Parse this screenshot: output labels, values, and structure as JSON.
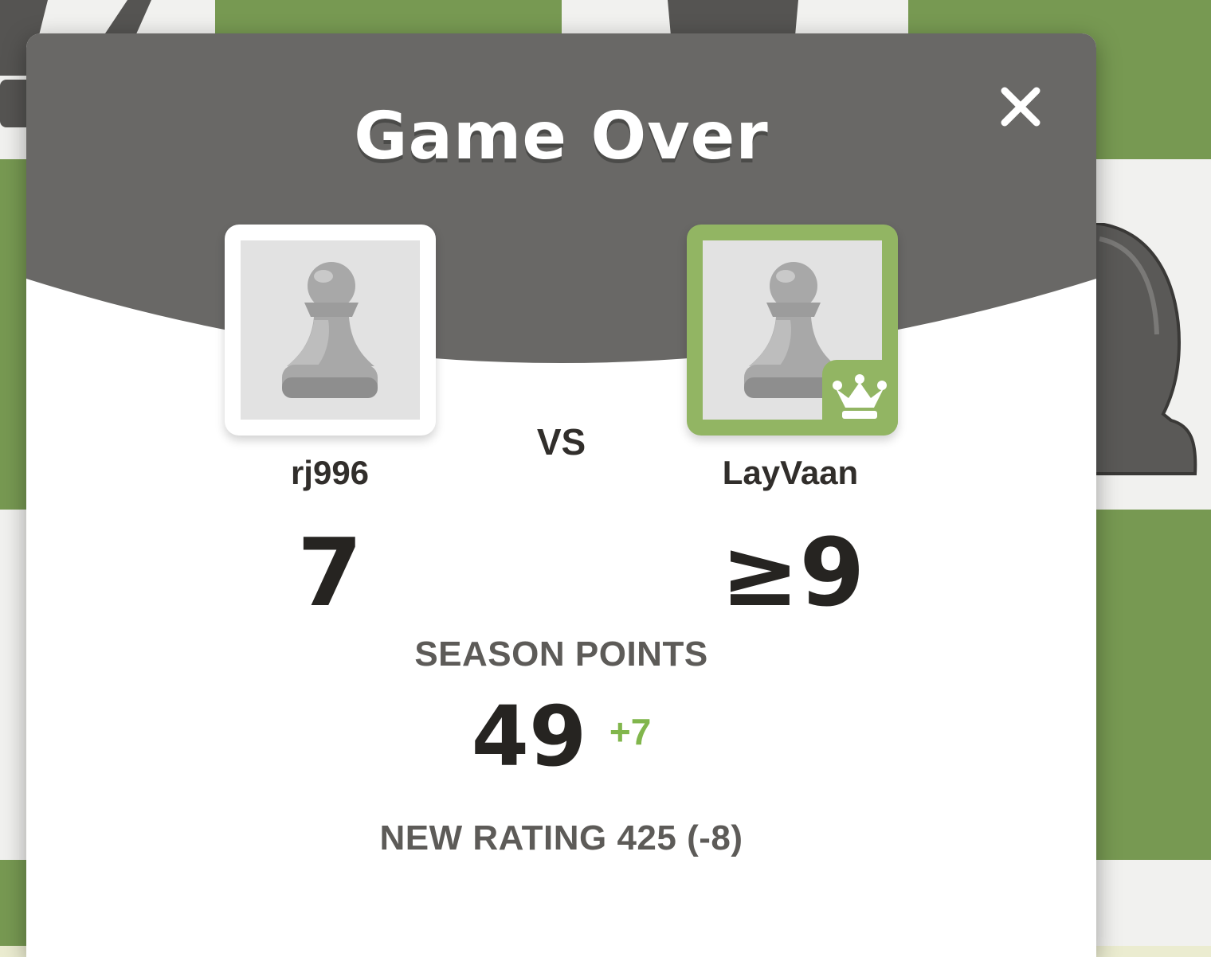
{
  "modal": {
    "title": "Game Over",
    "close_icon": "close-icon"
  },
  "players": {
    "left": {
      "username": "rj996",
      "score": "7",
      "avatar_icon": "pawn-avatar-icon",
      "winner": false
    },
    "right": {
      "username": "LayVaan",
      "score": "≥9",
      "avatar_icon": "pawn-avatar-icon",
      "winner": true,
      "badge_icon": "crown-icon"
    }
  },
  "vs_label": "VS",
  "season": {
    "label": "SEASON POINTS",
    "value": "49",
    "delta": "+7"
  },
  "rating": {
    "label": "NEW RATING",
    "value": "425",
    "change": "(-8)"
  },
  "colors": {
    "header": "#696866",
    "winner_green": "#92b563",
    "delta_green": "#81b64c",
    "board_green": "#779952",
    "board_light": "#f1f1ef"
  }
}
